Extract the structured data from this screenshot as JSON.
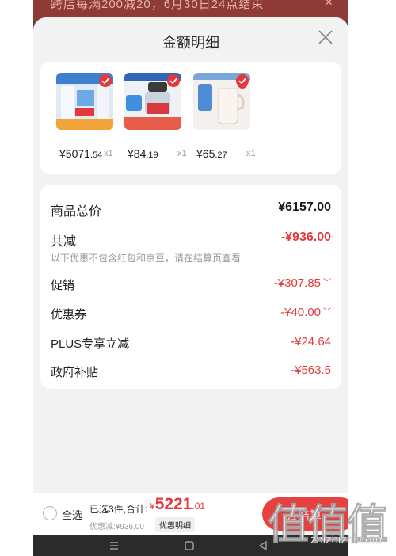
{
  "banner": {
    "text": "跨店每满200减20，6月30日24点结束",
    "close": "×"
  },
  "sheet": {
    "title": "金额明细"
  },
  "products": [
    {
      "price_int": "¥5071",
      "price_dec": ".54",
      "qty": "x1"
    },
    {
      "price_int": "¥84",
      "price_dec": ".19",
      "qty": "x1"
    },
    {
      "price_int": "¥65",
      "price_dec": ".27",
      "qty": "x1"
    }
  ],
  "summary": {
    "total_label": "商品总价",
    "total_value": "¥6157.00",
    "reduce_label": "共减",
    "reduce_value": "-¥936.00",
    "note": "以下优惠不包含红包和京豆，请在结算页查看",
    "rows": [
      {
        "label": "促销",
        "value": "-¥307.85"
      },
      {
        "label": "优惠券",
        "value": "-¥40.00"
      },
      {
        "label": "PLUS专享立减",
        "value": "-¥24.64"
      },
      {
        "label": "政府补贴",
        "value": "-¥563.5"
      }
    ]
  },
  "footer": {
    "select_all": "全选",
    "selected_info": "已选3件,合计:",
    "total_currency": "¥",
    "total_int": "5221",
    "total_dec": ".01",
    "discount": "优惠减:¥936.00",
    "detail_tag": "优惠明细",
    "pay_label": "去结算"
  },
  "watermark": {
    "chars": "值值值",
    "url": "zhizhizhi.com"
  },
  "colors": {
    "accent": "#e4393c",
    "sheet_bg": "#f2f2f2",
    "banner": "#8e3a36"
  }
}
